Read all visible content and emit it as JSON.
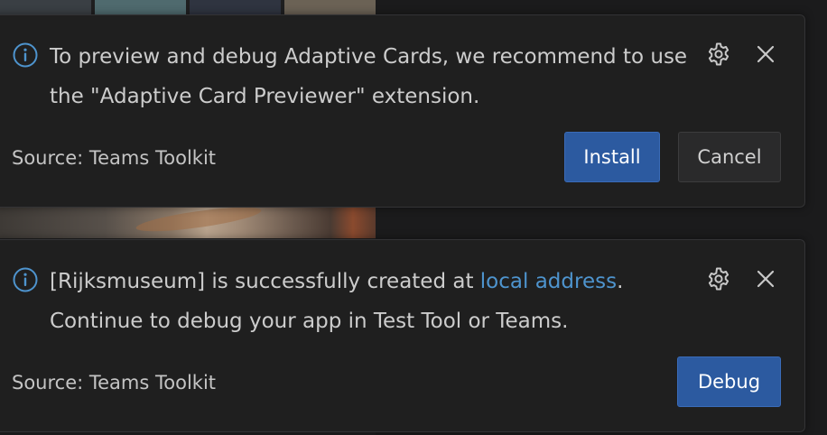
{
  "colors": {
    "accent": "#2c5aa0",
    "link": "#4e94ce",
    "info_icon": "#4e94ce",
    "toast_bg": "#1f1f1f",
    "text": "#cccccc"
  },
  "toasts": [
    {
      "icon": "info-icon",
      "message_parts": {
        "text": "To preview and debug Adaptive Cards, we recommend to use the \"Adaptive Card Previewer\" extension."
      },
      "settings_icon": "gear-icon",
      "close_icon": "close-icon",
      "source": "Source: Teams Toolkit",
      "buttons": {
        "install": "Install",
        "cancel": "Cancel"
      }
    },
    {
      "icon": "info-icon",
      "message_parts": {
        "before_link": "[Rijksmuseum] is successfully created at ",
        "link": "local address",
        "after_link": ".",
        "line2": "Continue to debug your app in Test Tool or Teams."
      },
      "settings_icon": "gear-icon",
      "close_icon": "close-icon",
      "source": "Source: Teams Toolkit",
      "buttons": {
        "debug": "Debug"
      }
    }
  ]
}
